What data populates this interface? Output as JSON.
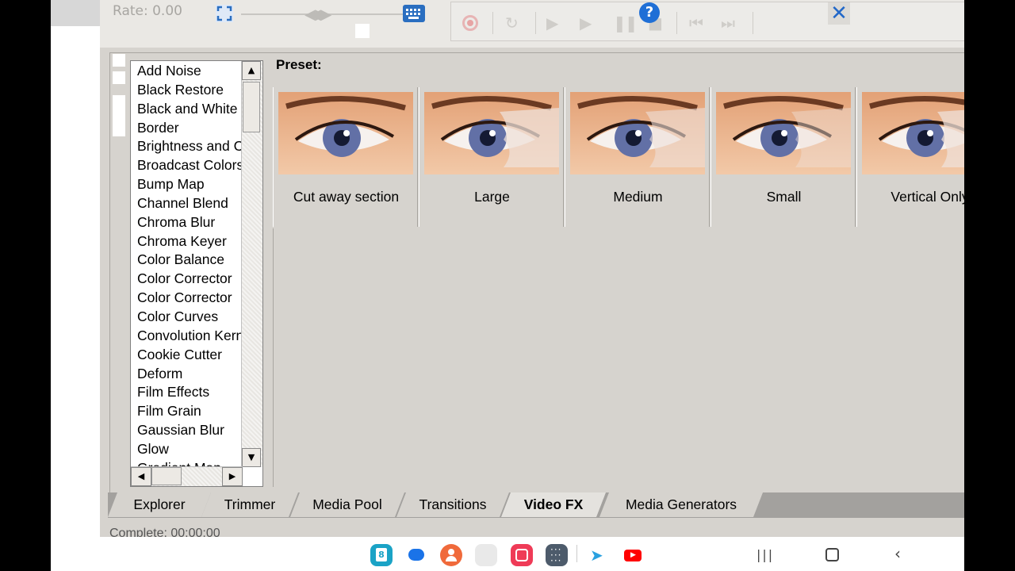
{
  "toolbar": {
    "rate_label": "Rate: 0.00",
    "icons": [
      "fullscreen-icon",
      "fast-forward-icon",
      "keyboard-icon",
      "record-icon",
      "refresh-icon",
      "play-icon",
      "play-from-start-icon",
      "pause-icon",
      "stop-icon",
      "previous-icon",
      "next-icon",
      "help-icon",
      "close-icon"
    ],
    "help_glyph": "?",
    "close_glyph": "✕"
  },
  "fx_list": {
    "items": [
      "Add Noise",
      "Black Restore",
      "Black and White",
      "Border",
      "Brightness and Contrast",
      "Broadcast Colors",
      "Bump Map",
      "Channel Blend",
      "Chroma Blur",
      "Chroma Keyer",
      "Color Balance",
      "Color Corrector",
      "Color Corrector",
      "Color Curves",
      "Convolution Kernel",
      "Cookie Cutter",
      "Deform",
      "Film Effects",
      "Film Grain",
      "Gaussian Blur",
      "Glow",
      "Gradient Map"
    ]
  },
  "preset": {
    "label": "Preset:",
    "items": [
      {
        "label": "Cut away section"
      },
      {
        "label": "Large"
      },
      {
        "label": "Medium"
      },
      {
        "label": "Small"
      },
      {
        "label": "Vertical Only"
      }
    ]
  },
  "tabs": [
    {
      "label": "Explorer",
      "active": false
    },
    {
      "label": "Trimmer",
      "active": false
    },
    {
      "label": "Media Pool",
      "active": false
    },
    {
      "label": "Transitions",
      "active": false
    },
    {
      "label": "Video FX",
      "active": true
    },
    {
      "label": "Media Generators",
      "active": false
    }
  ],
  "status": {
    "text": "Complete: 00:00:00"
  },
  "taskbar": {
    "apps": [
      {
        "name": "calendar-app-icon",
        "color": "#1ba3c6",
        "glyph": "8"
      },
      {
        "name": "messages-app-icon",
        "color": "#1a73e8",
        "glyph": ""
      },
      {
        "name": "contacts-app-icon",
        "color": "#f06a3b",
        "glyph": ""
      },
      {
        "name": "folder-app-icon",
        "color": "#e9e9e9",
        "glyph": ""
      },
      {
        "name": "camera-app-icon",
        "color": "#ef3b57",
        "glyph": ""
      },
      {
        "name": "apps-grid-icon",
        "color": "#4d5b6b",
        "glyph": ""
      },
      {
        "name": "telegram-app-icon",
        "color": "#ffffff",
        "glyph": ""
      },
      {
        "name": "youtube-app-icon",
        "color": "#ffffff",
        "glyph": ""
      }
    ]
  }
}
